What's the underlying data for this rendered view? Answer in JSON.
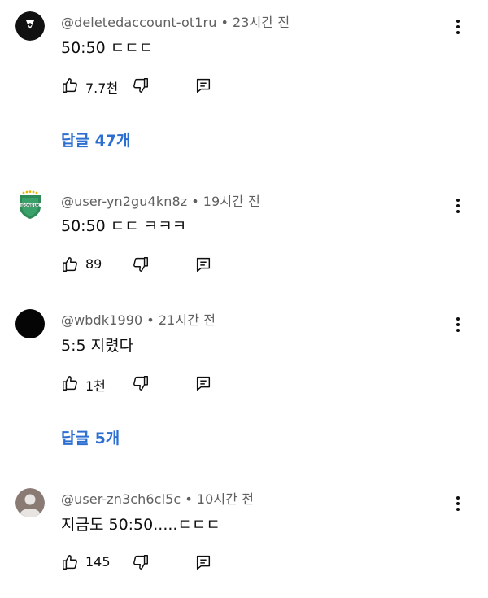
{
  "comments": [
    {
      "author": "@deletedaccount-ot1ru",
      "separator": "•",
      "time": "23시간 전",
      "text": "50:50 ㄷㄷㄷ",
      "likes": "7.7천",
      "avatar_icon": "tuxedo-avatar-icon",
      "replies_label": "답글 47개"
    },
    {
      "author": "@user-yn2gu4kn8z",
      "separator": "•",
      "time": "19시간 전",
      "text": "50:50 ㄷㄷ ㅋㅋㅋ",
      "likes": "89",
      "avatar_icon": "jeonbuk-emblem-icon",
      "avatar_text": "JEONBUK"
    },
    {
      "author": "@wbdk1990",
      "separator": "•",
      "time": "21시간 전",
      "text": "5:5 지렸다",
      "likes": "1천",
      "avatar_icon": "black-circle-avatar-icon",
      "replies_label": "답글 5개"
    },
    {
      "author": "@user-zn3ch6cl5c",
      "separator": "•",
      "time": "10시간 전",
      "text": "지금도 50:50.....ㄷㄷㄷ",
      "likes": "145",
      "avatar_icon": "default-person-avatar-icon"
    }
  ],
  "colors": {
    "text_primary": "#0f0f0f",
    "text_secondary": "#606060",
    "link_blue": "#2c6fd1",
    "emblem_green": "#2e8b57"
  }
}
